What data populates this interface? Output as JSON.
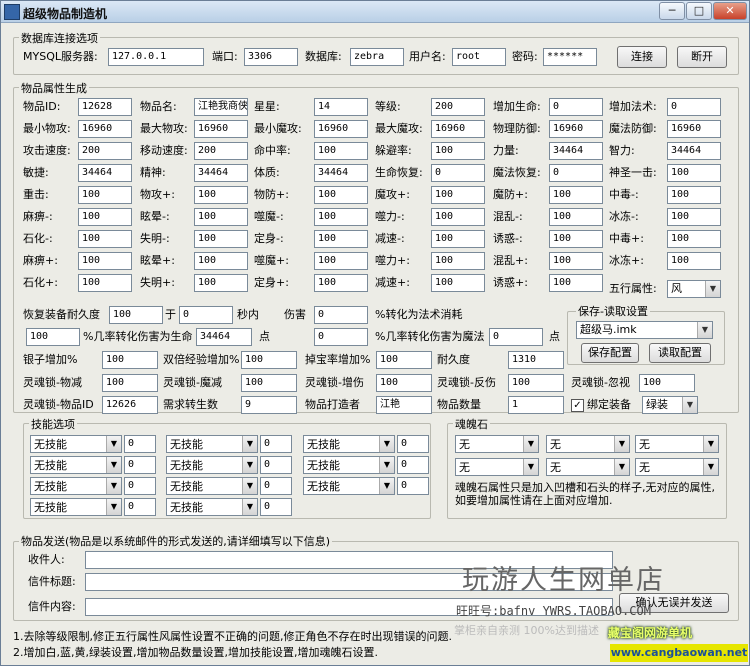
{
  "window": {
    "title": "超级物品制造机",
    "min": "─",
    "max": "□",
    "close": "✕"
  },
  "db": {
    "title": "数据库连接选项",
    "server_label": "MYSQL服务器:",
    "server": "127.0.0.1",
    "port_label": "端口:",
    "port": "3306",
    "db_label": "数据库:",
    "db": "zebra",
    "user_label": "用户名:",
    "user": "root",
    "pwd_label": "密码:",
    "pwd": "******",
    "connect": "连接",
    "disconnect": "断开"
  },
  "gen": {
    "title": "物品属性生成",
    "rows": [
      [
        [
          "物品ID:",
          "12628"
        ],
        [
          "物品名:",
          "江艳我商侠"
        ],
        [
          "星星:",
          "14"
        ],
        [
          "等级:",
          "200"
        ],
        [
          "增加生命:",
          "0"
        ],
        [
          "增加法术:",
          "0"
        ]
      ],
      [
        [
          "最小物攻:",
          "16960"
        ],
        [
          "最大物攻:",
          "16960"
        ],
        [
          "最小魔攻:",
          "16960"
        ],
        [
          "最大魔攻:",
          "16960"
        ],
        [
          "物理防御:",
          "16960"
        ],
        [
          "魔法防御:",
          "16960"
        ]
      ],
      [
        [
          "攻击速度:",
          "200"
        ],
        [
          "移动速度:",
          "200"
        ],
        [
          "命中率:",
          "100"
        ],
        [
          "躲避率:",
          "100"
        ],
        [
          "力量:",
          "34464"
        ],
        [
          "智力:",
          "34464"
        ]
      ],
      [
        [
          "敏捷:",
          "34464"
        ],
        [
          "精神:",
          "34464"
        ],
        [
          "体质:",
          "34464"
        ],
        [
          "生命恢复:",
          "0"
        ],
        [
          "魔法恢复:",
          "0"
        ],
        [
          "神圣一击:",
          "100"
        ]
      ],
      [
        [
          "重击:",
          "100"
        ],
        [
          "物攻+:",
          "100"
        ],
        [
          "物防+:",
          "100"
        ],
        [
          "魔攻+:",
          "100"
        ],
        [
          "魔防+:",
          "100"
        ],
        [
          "中毒-:",
          "100"
        ]
      ],
      [
        [
          "麻痹-:",
          "100"
        ],
        [
          "眩晕-:",
          "100"
        ],
        [
          "噬魔-:",
          "100"
        ],
        [
          "噬力-:",
          "100"
        ],
        [
          "混乱-:",
          "100"
        ],
        [
          "冰冻-:",
          "100"
        ]
      ],
      [
        [
          "石化-:",
          "100"
        ],
        [
          "失明-:",
          "100"
        ],
        [
          "定身-:",
          "100"
        ],
        [
          "减速-:",
          "100"
        ],
        [
          "诱惑-:",
          "100"
        ],
        [
          "中毒+:",
          "100"
        ]
      ],
      [
        [
          "麻痹+:",
          "100"
        ],
        [
          "眩晕+:",
          "100"
        ],
        [
          "噬魔+:",
          "100"
        ],
        [
          "噬力+:",
          "100"
        ],
        [
          "混乱+:",
          "100"
        ],
        [
          "冰冻+:",
          "100"
        ]
      ],
      [
        [
          "石化+:",
          "100"
        ],
        [
          "失明+:",
          "100"
        ],
        [
          "定身+:",
          "100"
        ],
        [
          "减速+:",
          "100"
        ],
        [
          "诱惑+:",
          "100"
        ]
      ]
    ],
    "element_label": "五行属性:",
    "element": "风",
    "restore_label": "恢复装备耐久度",
    "restore": "100",
    "yu": "于",
    "secs": "0",
    "secs_unit": "秒内",
    "dmg_label": "伤害",
    "dmg": "0",
    "magic_label": "%转化为法术消耗",
    "hp_pct": "100",
    "hp_label": "%几率转化伤害为生命",
    "hp_val": "34464",
    "dian1": "点",
    "mp_pct": "0",
    "mp_label": "%几率转化伤害为魔法",
    "mp_val": "0",
    "dian2": "点",
    "r2": [
      [
        "银子增加%",
        "100"
      ],
      [
        "双倍经验增加%",
        "100"
      ],
      [
        "掉宝率增加%",
        "100"
      ],
      [
        "耐久度",
        "1310"
      ]
    ],
    "r3": [
      [
        "灵魂锁-物减",
        "100"
      ],
      [
        "灵魂锁-魔减",
        "100"
      ],
      [
        "灵魂锁-增伤",
        "100"
      ],
      [
        "灵魂锁-反伤",
        "100"
      ],
      [
        "灵魂锁-忽视",
        "100"
      ]
    ],
    "r4": [
      [
        "灵魂锁-物品ID",
        "12626"
      ],
      [
        "需求转生数",
        "9"
      ],
      [
        "物品打造者",
        "江艳"
      ],
      [
        "物品数量",
        "1"
      ]
    ],
    "bind_label": "绑定装备",
    "bind": "绿装"
  },
  "save": {
    "title": "保存-读取设置",
    "file": "超级马.imk",
    "save": "保存配置",
    "load": "读取配置"
  },
  "skill": {
    "title": "技能选项",
    "none": "无技能",
    "zero": "0"
  },
  "soul": {
    "title": "魂魄石",
    "none": "无",
    "note": "魂魄石属性只是加入凹槽和石头的样子,无对应的属性,如要增加属性请在上面对应增加."
  },
  "send": {
    "title": "物品发送(物品是以系统邮件的形式发送的,请详细填写以下信息)",
    "recv": "收件人:",
    "subj": "信件标题:",
    "body": "信件内容:",
    "btn": "确认无误并发送"
  },
  "notes": [
    "1.去除等级限制,修正五行属性风属性设置不正确的问题,修正角色不存在时出现错误的问题.",
    "2.增加白,蓝,黄,绿装设置,增加物品数量设置,增加技能设置,增加魂魄石设置."
  ],
  "wm": {
    "t1": "玩游人生网单店",
    "t2": "旺旺号:bafnv  YWRS.TAOBAO.COM",
    "t3": "掌柜亲自亲测 100%达到描述",
    "t4": "藏宝阁网游单机",
    "t5": "www.cangbaowan.net"
  }
}
